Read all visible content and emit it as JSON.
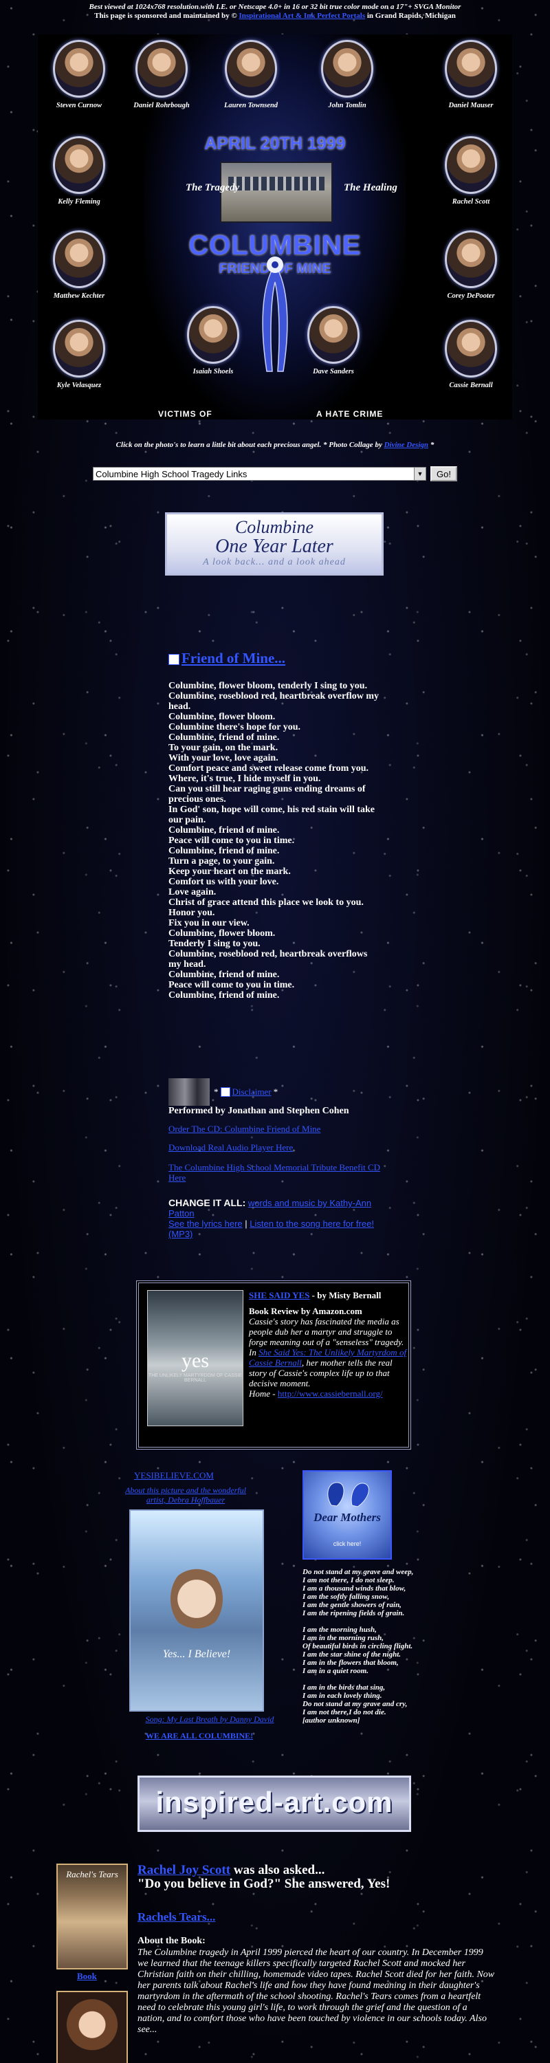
{
  "header": {
    "line1": "Best viewed at 1024x768 resolution with I.E. or Netscape 4.0+ in 16 or 32 bit true color mode on a 17\"+ SVGA Monitor",
    "line2_prefix": "This page is sponsored and maintained by ©",
    "line2_link": "Inspirational Art & Ink Perfect Portals",
    "line2_suffix": "in Grand Rapids, Michigan"
  },
  "collage": {
    "victims": [
      {
        "name": "Steven Curnow"
      },
      {
        "name": "Daniel Rohrbough"
      },
      {
        "name": "Lauren Townsend"
      },
      {
        "name": "John Tomlin"
      },
      {
        "name": "Daniel Mauser"
      },
      {
        "name": "Kelly Fleming"
      },
      {
        "name": "Rachel Scott"
      },
      {
        "name": "Matthew Kechter"
      },
      {
        "name": "Corey DePooter"
      },
      {
        "name": "Kyle Velasquez"
      },
      {
        "name": "Isaiah Shoels"
      },
      {
        "name": "Dave Sanders"
      },
      {
        "name": "Cassie Bernall"
      }
    ],
    "date": "APRIL 20TH 1999",
    "the_tragedy": "The Tragedy",
    "the_healing": "The Healing",
    "columbine": "COLUMBINE",
    "friend_of_mine": "FRIEND OF MINE",
    "victims_of": "VICTIMS OF",
    "a_hate_crime": "A HATE CRIME"
  },
  "click_note": {
    "text": "Click on the photo's to learn a little bit about each precious angel. * Photo Collage by",
    "link": "Divine Design",
    "suffix": "*"
  },
  "links_select": {
    "selected": "Columbine High School Tragedy Links",
    "go_label": "Go!"
  },
  "one_year_banner": {
    "line1": "Columbine",
    "line2": "One Year Later",
    "line3": "A look back... and a look ahead"
  },
  "song": {
    "title": "Friend of Mine...",
    "lyrics": [
      "Columbine, flower bloom, tenderly I sing to you.",
      "Columbine, roseblood red, heartbreak overflow my head.",
      "Columbine, flower bloom.",
      "Columbine there's hope for you.",
      "Columbine, friend of mine.",
      "To your gain, on the mark.",
      "With your love, love again.",
      "Comfort peace and sweet release come from you.",
      "Where, it's true, I hide myself in you.",
      "Can you still hear raging guns ending dreams of precious ones.",
      "In God' son, hope will come, his red stain will take our pain.",
      "Columbine, friend of mine.",
      "Peace will come to you in time.",
      "Columbine, friend of mine.",
      "Turn a page, to your gain.",
      "Keep your heart on the mark.",
      "Comfort us with your love.",
      "Love again.",
      "Christ of grace attend this place we look to you.",
      "Honor you.",
      "Fix you in our view.",
      "Columbine, flower bloom.",
      "Tenderly I sing to you.",
      "Columbine, roseblood red, heartbreak overflows my head.",
      "Columbine, friend of mine.",
      "Peace will come to you in time.",
      "Columbine, friend of mine."
    ],
    "disclaimer_link": "Disclaimer",
    "performed_by": "Performed by Jonathan and Stephen Cohen",
    "cd_link": "Order The CD: Columbine Friend of Mine",
    "plugin_link": "Download Real Audio Player Here",
    "tribute_link": "The Columbine High School Memorial Tribute Benefit CD Here",
    "change_label": "CHANGE IT ALL:",
    "change_link": "words and music by Kathy-Ann Patton",
    "lyrics_link": "See the lyrics here",
    "listen_link": "Listen to the song here for free! (MP3)"
  },
  "she_said_yes": {
    "cover_title": "yes",
    "cover_sub": "THE UNLIKELY MARTYRDOM OF CASSIE BERNALL",
    "title_link": "SHE SAID YES",
    "byline": "- by Misty Bernall",
    "review_heading": "Book Review by Amazon.com",
    "review_text": "Cassie's story has fascinated the media as people dub her a martyr and struggle to forge meaning out of a \"senseless\" tragedy. In",
    "review_link": "She Said Yes: The Unlikely Martyrdom of Cassie Bernall",
    "review_text2": ", her mother tells the real story of Cassie's complex life up to that decisive moment.",
    "home_label": "Home -",
    "home_link": "http://www.cassiebernall.org/"
  },
  "yes_i_believe": {
    "title_link": "YESIBELIEVE.COM",
    "caption_link": "About this picture and the wonderful artist, Debra Hoffbauer",
    "image_text": "Yes... I Believe!",
    "song_link": "Song: My Last Breath by Danny David",
    "we_are_link": "WE ARE ALL COLUMBINE!"
  },
  "dear_mothers": {
    "title": "Dear Mothers",
    "click": "click here!"
  },
  "dont_stand_poem": [
    "Do not stand at my grave and weep,",
    "I am not there, I do not sleep.",
    "I am a thousand winds that blow,",
    "I am the softly falling snow,",
    "I am the gentle showers of rain,",
    "I am the ripening fields of grain.",
    "",
    "I am the morning hush,",
    "I am in the morning rush,",
    "Of beautiful birds in circling flight.",
    "I am the star shine of the night.",
    "I am in the flowers that bloom,",
    "I am in a quiet room.",
    "",
    "I am in the birds that sing,",
    "I am in each lovely thing.",
    "Do not stand at my grave and cry,",
    "I am not there,I do not die.",
    "[author unknown]"
  ],
  "inspired_banner": {
    "text": "inspired-art.com"
  },
  "rachels_tears": {
    "cover_title": "Rachel's Tears",
    "book_link": "Book",
    "asked_link": "Rachel Joy Scott",
    "asked_text": "was also asked...",
    "quote": "\"Do you believe in God?\" She answered, Yes!",
    "title_link": "Rachels Tears...",
    "about_heading": "About the Book:",
    "about_text": "The Columbine tragedy in April 1999 pierced the heart of our country. In December 1999 we learned that the teenage killers specifically targeted Rachel Scott and mocked her Christian faith on their chilling, homemade video tapes. Rachel Scott died for her faith. Now her parents talk about Rachel's life and how they have found meaning in their daughter's martyrdom in the aftermath of the school shooting. Rachel's Tears comes from a heartfelt need to celebrate this young girl's life, to work through the grief and the question of a nation, and to comfort those who have been touched by violence in our schools today. Also see..."
  }
}
